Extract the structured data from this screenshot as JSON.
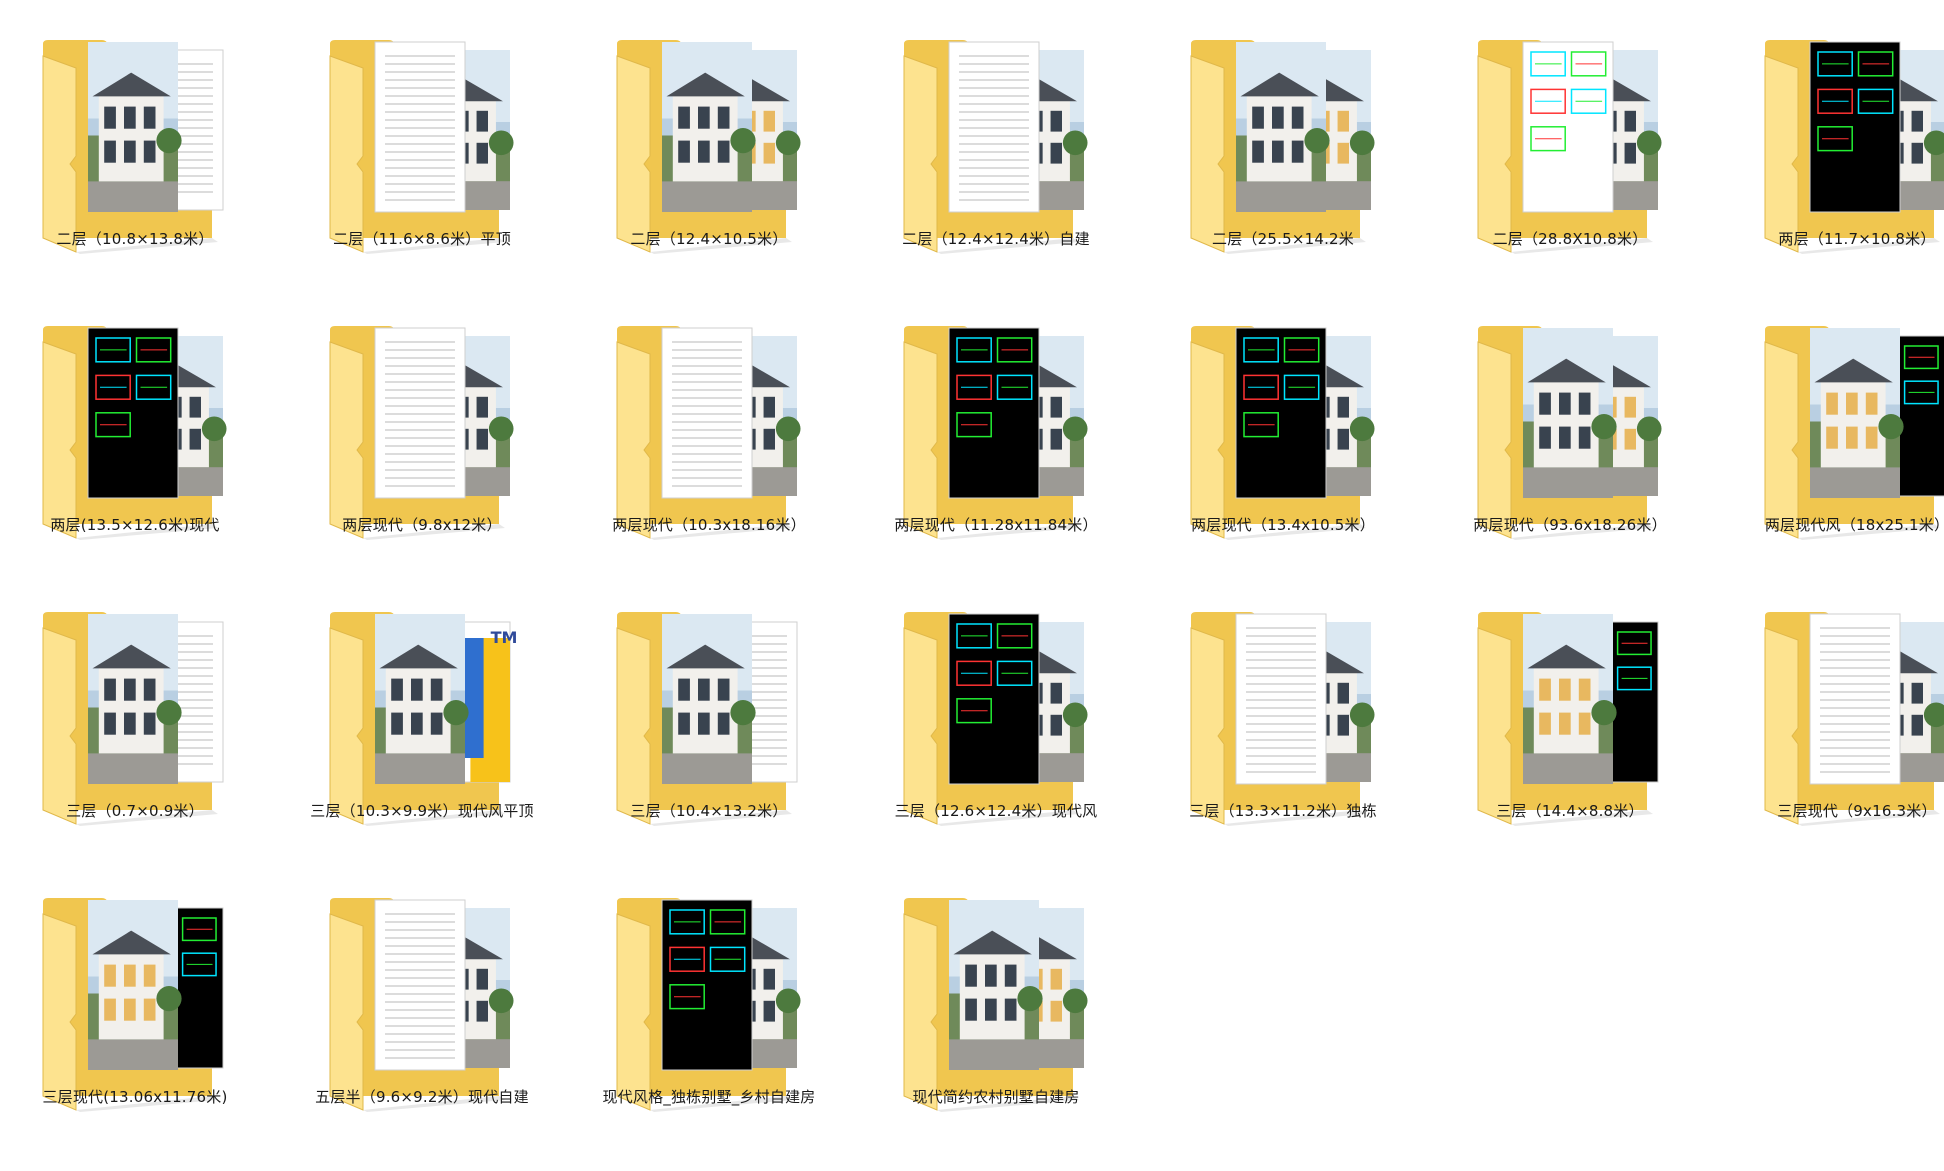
{
  "folders": [
    {
      "name": "二层（10.8×13.8米）",
      "preview": "photo-doc"
    },
    {
      "name": "二层（11.6×8.6米）平顶",
      "preview": "doc-photo"
    },
    {
      "name": "二层（12.4×10.5米）",
      "preview": "render-photo"
    },
    {
      "name": "二层（12.4×12.4米）自建",
      "preview": "doc-photo"
    },
    {
      "name": "二层（25.5×14.2米",
      "preview": "photo-photo"
    },
    {
      "name": "二层（28.8X10.8米）",
      "preview": "cad-white-photo"
    },
    {
      "name": "两层（11.7×10.8米）",
      "preview": "cad-black-photo"
    },
    {
      "name": "两层(13.5×12.6米)现代",
      "preview": "cad-black-photo"
    },
    {
      "name": "两层现代（9.8x12米）",
      "preview": "doc-photo"
    },
    {
      "name": "两层现代（10.3x18.16米）",
      "preview": "doc-photo"
    },
    {
      "name": "两层现代（11.28x11.84米）",
      "preview": "cad-black-photo"
    },
    {
      "name": "两层现代（13.4x10.5米）",
      "preview": "cad-black-photo"
    },
    {
      "name": "两层现代（93.6x18.26米）",
      "preview": "photo-photo"
    },
    {
      "name": "两层现代风（18x25.1米）",
      "preview": "photo-cad"
    },
    {
      "name": "三层（0.7×0.9米）",
      "preview": "photo-doc"
    },
    {
      "name": "三层（10.3×9.9米）现代风平顶",
      "preview": "photo-blue"
    },
    {
      "name": "三层（10.4×13.2米）",
      "preview": "photo-doc"
    },
    {
      "name": "三层（12.6×12.4米）现代风",
      "preview": "cad-black-photo"
    },
    {
      "name": "三层（13.3×11.2米）独栋",
      "preview": "doc-photo"
    },
    {
      "name": "三层（14.4×8.8米）",
      "preview": "render-cad"
    },
    {
      "name": "三层现代（9x16.3米）",
      "preview": "doc-photo"
    },
    {
      "name": "三层现代(13.06x11.76米)",
      "preview": "photo-cad"
    },
    {
      "name": "五层半（9.6×9.2米）现代自建",
      "preview": "doc-photo"
    },
    {
      "name": "现代风格_独栋别墅_乡村自建房",
      "preview": "cad-black-photo"
    },
    {
      "name": "现代简约农村别墅自建房",
      "preview": "photo-photo"
    }
  ],
  "blue_card_text": "TM",
  "colors": {
    "folder_back": "#f0c64f",
    "folder_front": "#fde38f",
    "cad_background": "#000000",
    "cad_cyan": "#00e5ff",
    "cad_green": "#22ee33",
    "cad_red": "#ff3333",
    "blue_card": "#2f6fcf",
    "yellow_card": "#f7c21a"
  }
}
